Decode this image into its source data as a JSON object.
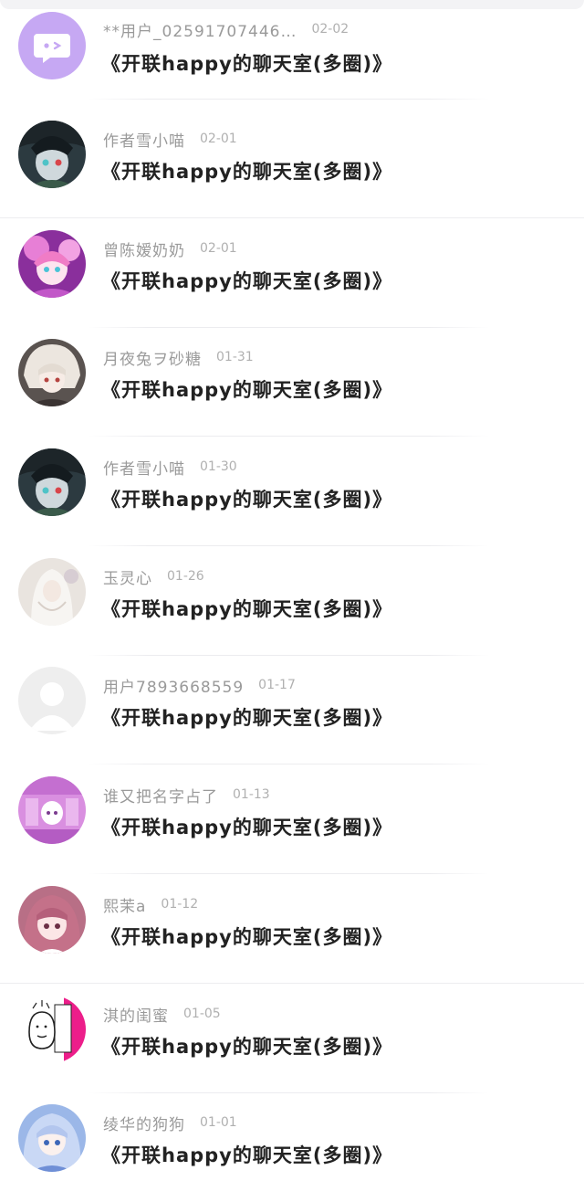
{
  "messages": [
    {
      "user": "**用户_02591707446…",
      "date": "02-02",
      "title": "《开联happy的聊天室(多圈)》",
      "avatar": "chat-bubble-icon"
    },
    {
      "user": "作者雪小喵",
      "date": "02-01",
      "title": "《开联happy的聊天室(多圈)》",
      "avatar": "anime-avatar-dark"
    },
    {
      "user": "曾陈嫒奶奶",
      "date": "02-01",
      "title": "《开联happy的聊天室(多圈)》",
      "avatar": "anime-avatar-pink"
    },
    {
      "user": "月夜兔ヲ砂糖",
      "date": "01-31",
      "title": "《开联happy的聊天室(多圈)》",
      "avatar": "anime-avatar-white-hair"
    },
    {
      "user": "作者雪小喵",
      "date": "01-30",
      "title": "《开联happy的聊天室(多圈)》",
      "avatar": "anime-avatar-dark"
    },
    {
      "user": "玉灵心",
      "date": "01-26",
      "title": "《开联happy的聊天室(多圈)》",
      "avatar": "anime-avatar-pale"
    },
    {
      "user": "用户7893668559",
      "date": "01-17",
      "title": "《开联happy的聊天室(多圈)》",
      "avatar": "default-user-avatar"
    },
    {
      "user": "谁又把名字占了",
      "date": "01-13",
      "title": "《开联happy的聊天室(多圈)》",
      "avatar": "anime-avatar-purple"
    },
    {
      "user": "熙茉a",
      "date": "01-12",
      "title": "《开联happy的聊天室(多圈)》",
      "avatar": "anime-avatar-pink-hair"
    },
    {
      "user": "淇的闺蜜",
      "date": "01-05",
      "title": "《开联happy的聊天室(多圈)》",
      "avatar": "sketch-avatar-magenta"
    },
    {
      "user": "绫华的狗狗",
      "date": "01-01",
      "title": "《开联happy的聊天室(多圈)》",
      "avatar": "anime-avatar-blue"
    }
  ],
  "colors": {
    "username": "#9a9a9a",
    "date": "#b0b0b0",
    "title": "#222222",
    "accent_purple": "#c9a7f5"
  }
}
